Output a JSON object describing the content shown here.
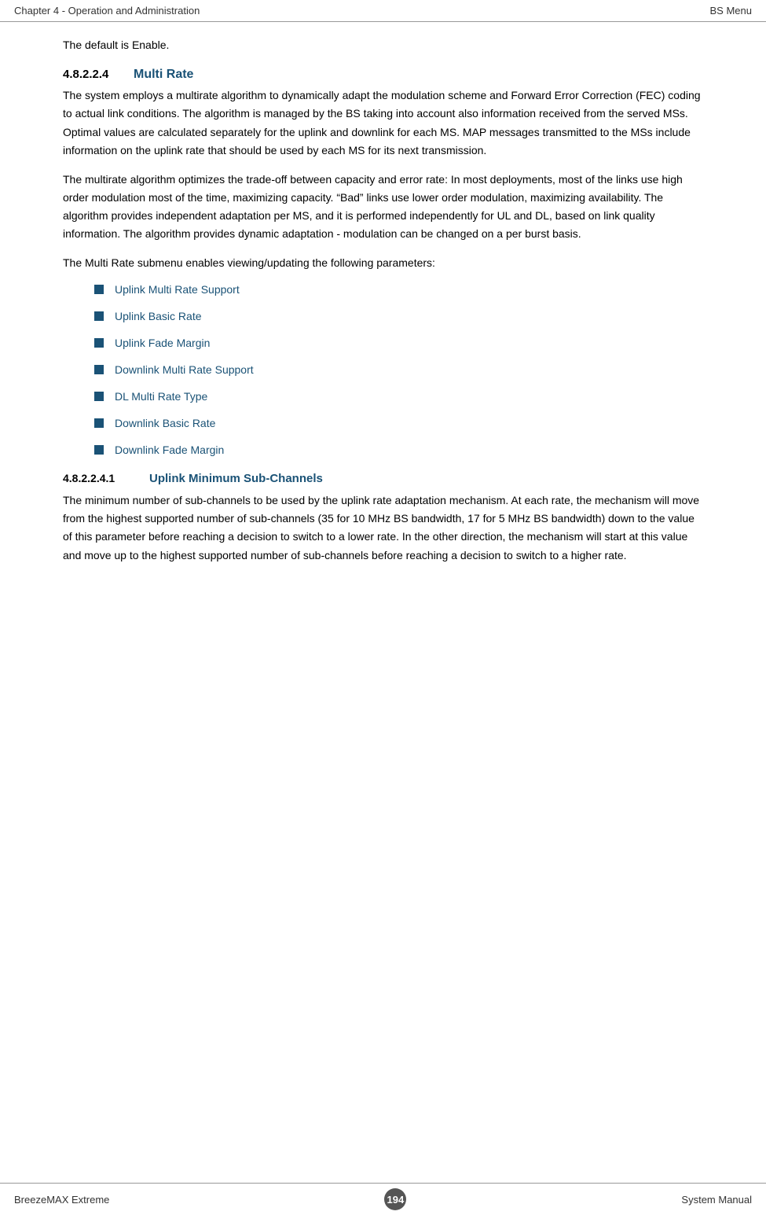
{
  "header": {
    "left": "Chapter 4 - Operation and Administration",
    "right": "BS Menu"
  },
  "footer": {
    "left": "BreezeMAX Extreme",
    "page": "194",
    "right": "System Manual"
  },
  "intro": {
    "text": "The default is Enable."
  },
  "section_482224": {
    "num": "4.8.2.2.4",
    "title": "Multi Rate",
    "para1": "The system employs a multirate algorithm to dynamically adapt the modulation scheme and Forward Error Correction (FEC) coding to actual link conditions. The algorithm is managed by the BS taking into account also information received from the served MSs. Optimal values are calculated separately for the uplink and downlink for each MS. MAP messages transmitted to the MSs include information on the uplink rate that should be used by each MS for its next transmission.",
    "para2": "The multirate algorithm optimizes the trade-off between capacity and error rate: In most deployments, most of the links use high order modulation most of the time, maximizing capacity. “Bad” links use lower order modulation, maximizing availability. The algorithm provides independent adaptation per MS, and it is performed independently for UL and DL, based on link quality information. The algorithm provides dynamic adaptation - modulation can be changed on a per burst basis.",
    "para3": "The Multi Rate submenu enables viewing/updating the following parameters:",
    "bullet_items": [
      "Uplink Multi Rate Support",
      "Uplink Basic Rate",
      "Uplink Fade Margin",
      "Downlink Multi Rate Support",
      "DL Multi Rate Type",
      "Downlink Basic Rate",
      "Downlink Fade Margin"
    ]
  },
  "section_4822241": {
    "num": "4.8.2.2.4.1",
    "title": "Uplink Minimum Sub-Channels",
    "para1": "The minimum number of sub-channels to be used by the uplink rate adaptation mechanism. At each rate, the mechanism will move from the highest supported number of sub-channels (35 for 10 MHz BS bandwidth, 17 for 5 MHz BS bandwidth) down to the value of this parameter before reaching a decision to switch to a lower rate. In the other direction, the mechanism will start at this value and move up to the highest supported number of sub-channels before reaching a decision to switch to a higher rate."
  }
}
